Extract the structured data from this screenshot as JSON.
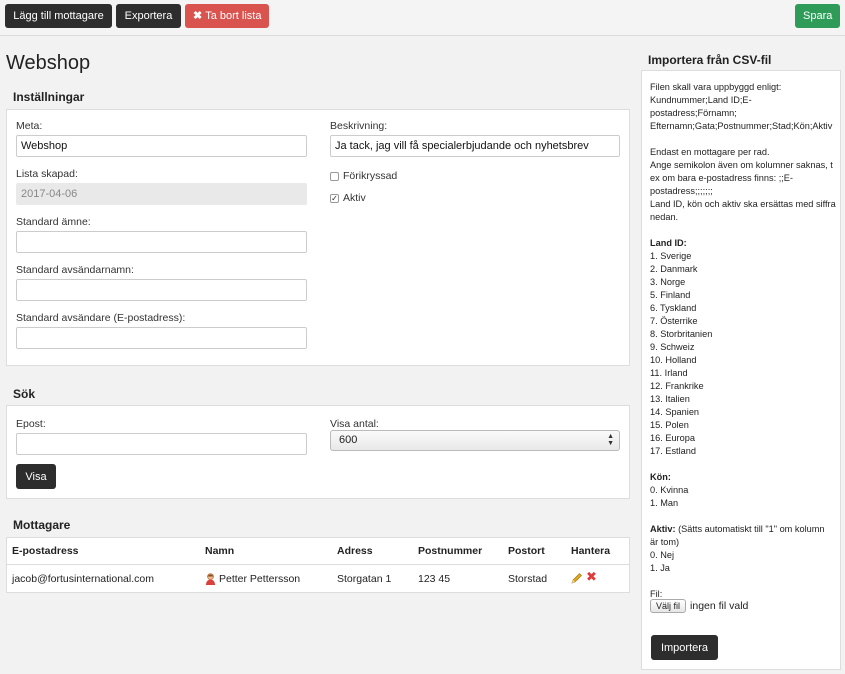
{
  "toolbar": {
    "add_recipient": "Lägg till mottagare",
    "export": "Exportera",
    "delete_list": "Ta bort lista",
    "delete_icon": "✖",
    "save": "Spara"
  },
  "page_title": "Webshop",
  "settings": {
    "title": "Inställningar",
    "meta_label": "Meta:",
    "meta_value": "Webshop",
    "created_label": "Lista skapad:",
    "created_value": "2017-04-06",
    "subject_label": "Standard ämne:",
    "subject_value": "",
    "sender_name_label": "Standard avsändarnamn:",
    "sender_name_value": "",
    "sender_email_label": "Standard avsändare (E-postadress):",
    "sender_email_value": "",
    "description_label": "Beskrivning:",
    "description_value": "Ja tack, jag vill få specialerbjudande och nyhetsbrev",
    "preselected_label": "Förikryssad",
    "preselected_checked": false,
    "active_label": "Aktiv",
    "active_checked": true
  },
  "search": {
    "title": "Sök",
    "email_label": "Epost:",
    "email_value": "",
    "count_label": "Visa antal:",
    "count_value": "600",
    "show_button": "Visa"
  },
  "recipients": {
    "title": "Mottagare",
    "columns": [
      "E-postadress",
      "Namn",
      "Adress",
      "Postnummer",
      "Postort",
      "Hantera"
    ],
    "rows": [
      {
        "email": "jacob@fortusinternational.com",
        "name": "Petter Pettersson",
        "address": "Storgatan 1",
        "zip": "123 45",
        "city": "Storstad"
      }
    ]
  },
  "import": {
    "title": "Importera från CSV-fil",
    "lines": [
      "Filen skall vara uppbyggd enligt:",
      "Kundnummer;Land ID;E-",
      "postadress;Förnamn;",
      "Efternamn;Gata;Postnummer;Stad;Kön;Aktiv",
      "",
      "Endast en mottagare per rad.",
      "Ange semikolon även om kolumner saknas, t",
      "ex om bara e-postadress finns: ;;E-",
      "postadress;;;;;;;",
      "Land ID, kön och aktiv ska ersättas med siffra",
      "nedan.",
      ""
    ],
    "country_heading": "Land ID:",
    "countries": [
      "1. Sverige",
      "2. Danmark",
      "3. Norge",
      "5. Finland",
      "6. Tyskland",
      "7. Österrike",
      "8. Storbritanien",
      "9. Schweiz",
      "10. Holland",
      "11. Irland",
      "12. Frankrike",
      "13. Italien",
      "14. Spanien",
      "15. Polen",
      "16. Europa",
      "17. Estland"
    ],
    "gender_heading": "Kön:",
    "genders": [
      "0. Kvinna",
      "1. Man"
    ],
    "active_heading": "Aktiv:",
    "active_note": " (Sätts automatiskt till \"1\" om kolumn",
    "active_note2": "är tom)",
    "active_values": [
      "0. Nej",
      "1. Ja"
    ],
    "file_label": "Fil:",
    "file_button": "Välj fil",
    "file_status": "ingen fil vald",
    "import_button": "Importera"
  },
  "colors": {
    "dark_button": "#2d2d2d",
    "danger": "#d9534f",
    "success": "#2e9c58",
    "delete_icon": "#e03a3a",
    "edit_icon": "#e0a81e"
  }
}
